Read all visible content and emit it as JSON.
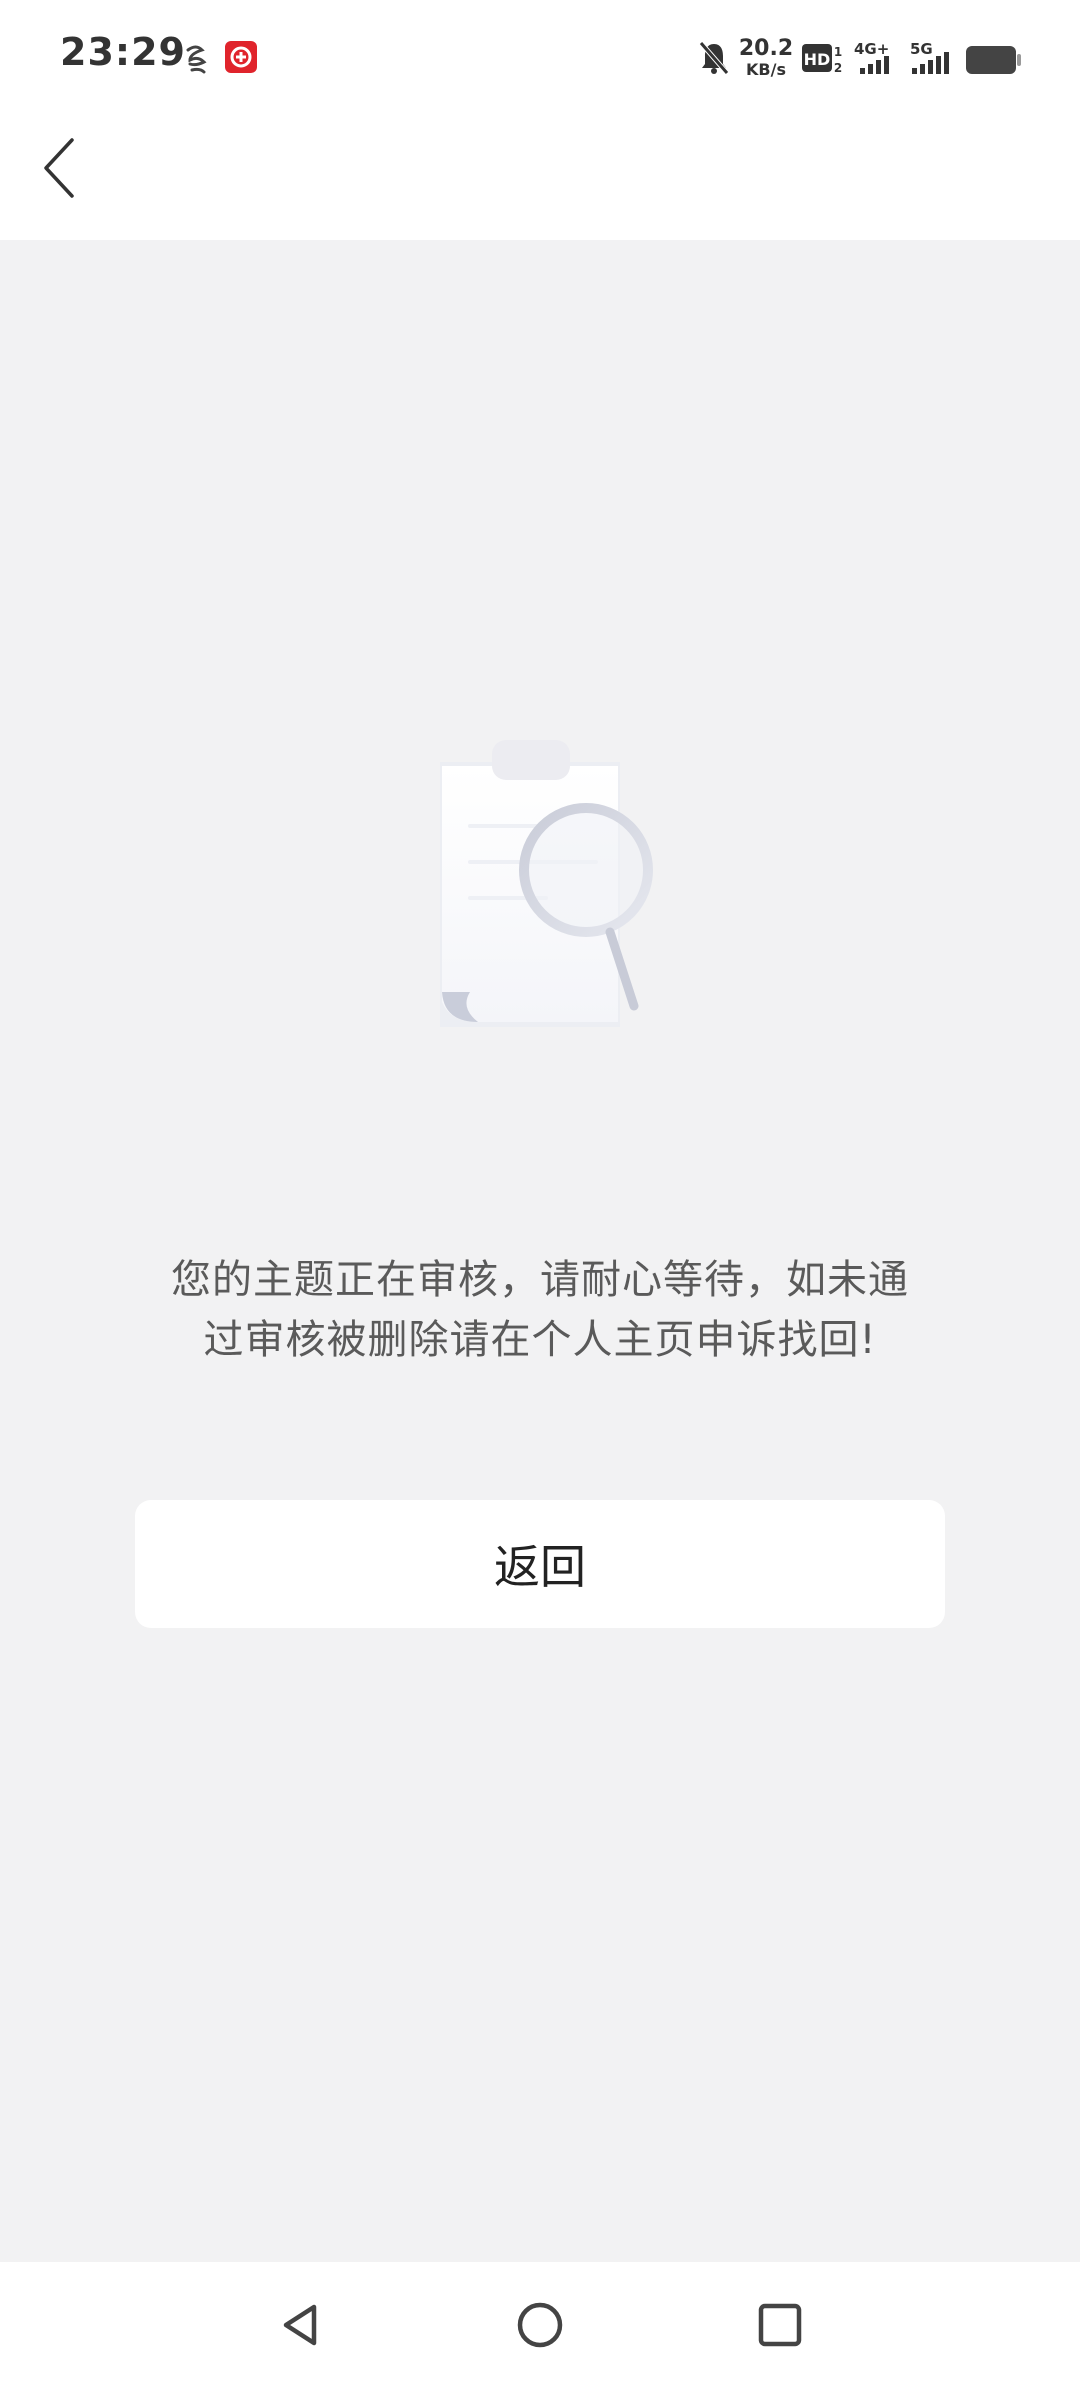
{
  "status_bar": {
    "time": "23:29",
    "network_speed": "20.2",
    "network_speed_unit": "KB/s",
    "hd_label": "HD",
    "signal1_label": "4G+",
    "signal2_label": "5G"
  },
  "header": {
    "back_icon": "chevron-left-icon"
  },
  "main": {
    "illustration_icon": "document-search-icon",
    "message": "您的主题正在审核，请耐心等待，如未通过审核被删除请在个人主页申诉找回!",
    "return_button_label": "返回"
  },
  "navigation": {
    "back_icon": "triangle-back-icon",
    "home_icon": "circle-home-icon",
    "recents_icon": "square-recents-icon"
  },
  "colors": {
    "background": "#f2f2f3",
    "surface": "#ffffff",
    "text_primary": "#222222",
    "text_secondary": "#5a5a5a"
  }
}
